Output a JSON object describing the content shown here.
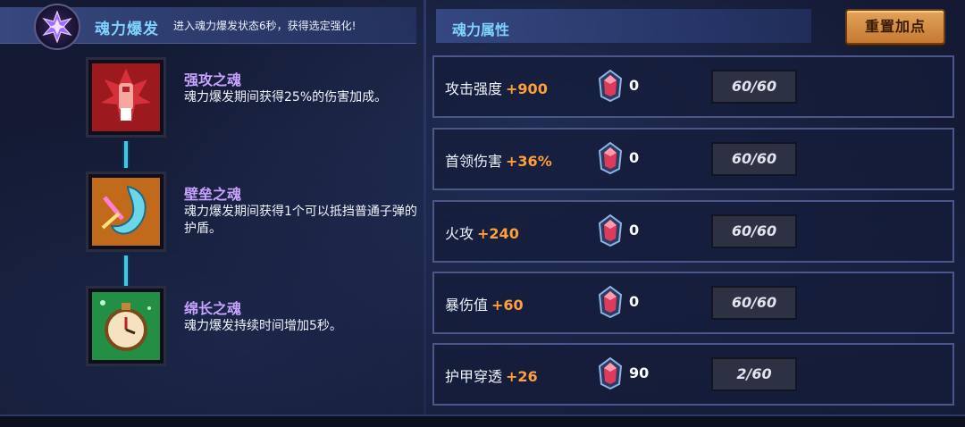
{
  "burst": {
    "title": "魂力爆发",
    "description": "进入魂力爆发状态6秒，获得选定强化!"
  },
  "skills": [
    {
      "name": "强攻之魂",
      "description": "魂力爆发期间获得25%的伤害加成。",
      "icon": "red-fist-icon"
    },
    {
      "name": "壁垒之魂",
      "description": "魂力爆发期间获得1个可以抵挡普通子弹的护盾。",
      "icon": "shield-swirl-icon"
    },
    {
      "name": "绵长之魂",
      "description": "魂力爆发持续时间增加5秒。",
      "icon": "stopwatch-icon"
    }
  ],
  "attributes_panel": {
    "title": "魂力属性",
    "reset_label": "重置加点",
    "rows": [
      {
        "name": "攻击强度",
        "bonus": "+900",
        "gems": "0",
        "level": "60/60"
      },
      {
        "name": "首领伤害",
        "bonus": "+36%",
        "gems": "0",
        "level": "60/60"
      },
      {
        "name": "火攻",
        "bonus": "+240",
        "gems": "0",
        "level": "60/60"
      },
      {
        "name": "暴伤值",
        "bonus": "+60",
        "gems": "0",
        "level": "60/60"
      },
      {
        "name": "护甲穿透",
        "bonus": "+26",
        "gems": "90",
        "level": "2/60"
      }
    ]
  },
  "colors": {
    "accent_blue": "#7fd1ff",
    "bonus_orange": "#ff9f3a",
    "skill_name_purple": "#c7a3ff",
    "button_orange": "#d98e45"
  }
}
